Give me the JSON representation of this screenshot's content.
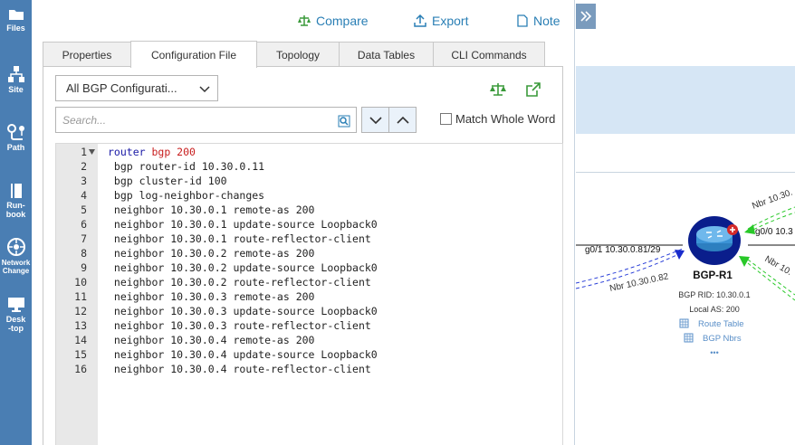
{
  "left_nav": [
    {
      "id": "files",
      "label": "Files",
      "icon": "folder-icon"
    },
    {
      "id": "site",
      "label": "Site",
      "icon": "site-icon"
    },
    {
      "id": "path",
      "label": "Path",
      "icon": "path-icon"
    },
    {
      "id": "runbook",
      "label_lines": [
        "Run-",
        "book"
      ],
      "icon": "runbook-icon"
    },
    {
      "id": "network-change",
      "label_lines": [
        "Network",
        "Change"
      ],
      "icon": "network-change-icon"
    },
    {
      "id": "desktop",
      "label_lines": [
        "Desk",
        "-top"
      ],
      "icon": "desktop-icon"
    }
  ],
  "toolbar": {
    "compare": "Compare",
    "export": "Export",
    "note": "Note"
  },
  "tabs": [
    {
      "label": "Properties",
      "active": false
    },
    {
      "label": "Configuration File",
      "active": true
    },
    {
      "label": "Topology",
      "active": false
    },
    {
      "label": "Data Tables",
      "active": false
    },
    {
      "label": "CLI Commands",
      "active": false
    }
  ],
  "filter": {
    "selected": "All BGP Configurati..."
  },
  "search": {
    "placeholder": "Search...",
    "match_whole_word_label": "Match Whole Word",
    "match_whole_word_checked": false
  },
  "config_lines": [
    {
      "num": "1",
      "text": "router bgp 200"
    },
    {
      "num": "2",
      "text": " bgp router-id 10.30.0.11"
    },
    {
      "num": "3",
      "text": " bgp cluster-id 100"
    },
    {
      "num": "4",
      "text": " bgp log-neighbor-changes"
    },
    {
      "num": "5",
      "text": " neighbor 10.30.0.1 remote-as 200"
    },
    {
      "num": "6",
      "text": " neighbor 10.30.0.1 update-source Loopback0"
    },
    {
      "num": "7",
      "text": " neighbor 10.30.0.1 route-reflector-client"
    },
    {
      "num": "8",
      "text": " neighbor 10.30.0.2 remote-as 200"
    },
    {
      "num": "9",
      "text": " neighbor 10.30.0.2 update-source Loopback0"
    },
    {
      "num": "10",
      "text": " neighbor 10.30.0.2 route-reflector-client"
    },
    {
      "num": "11",
      "text": " neighbor 10.30.0.3 remote-as 200"
    },
    {
      "num": "12",
      "text": " neighbor 10.30.0.3 update-source Loopback0"
    },
    {
      "num": "13",
      "text": " neighbor 10.30.0.3 route-reflector-client"
    },
    {
      "num": "14",
      "text": " neighbor 10.30.0.4 remote-as 200"
    },
    {
      "num": "15",
      "text": " neighbor 10.30.0.4 update-source Loopback0"
    },
    {
      "num": "16",
      "text": " neighbor 10.30.0.4 route-reflector-client"
    }
  ],
  "topology": {
    "device_name": "BGP-R1",
    "bgp_rid": "BGP RID: 10.30.0.1",
    "local_as": "Local AS: 200",
    "route_table": "Route Table",
    "bgp_nbrs": "BGP Nbrs",
    "more": "•••",
    "interface_left": "g0/1 10.30.0.81/29",
    "nbr_left": "Nbr 10.30.0.82",
    "nbr_top_right": "Nbr 10.30.",
    "interface_right": "g0/0 10.3",
    "nbr_bottom_right": "Nbr 10."
  },
  "colors": {
    "nav_bg": "#4a7eb3",
    "accent": "#2a7fb5",
    "green_icon": "#3a9a3a",
    "topo_header": "#d6e6f5"
  }
}
